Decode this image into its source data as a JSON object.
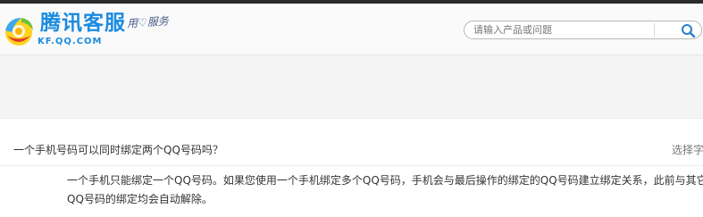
{
  "header": {
    "brand_name": "腾讯客服",
    "brand_domain": "KF.QQ.COM",
    "slogan": "用♡服务",
    "search": {
      "placeholder": "请输入产品或问题",
      "icon": "search-icon"
    }
  },
  "question": {
    "title": "一个手机号码可以同时绑定两个QQ号码吗？",
    "font_select_label": "选择字"
  },
  "answer": {
    "line1": "一个手机只能绑定一个QQ号码。如果您使用一个手机绑定多个QQ号码，手机会与最后操作的绑定的QQ号码建立绑定关系，此前与其它",
    "line2": "QQ号码的绑定均会自动解除。"
  },
  "colors": {
    "brand_blue": "#1a8be0",
    "top_bar": "#2b2b2b",
    "banner_bg": "#f4f4f4"
  }
}
